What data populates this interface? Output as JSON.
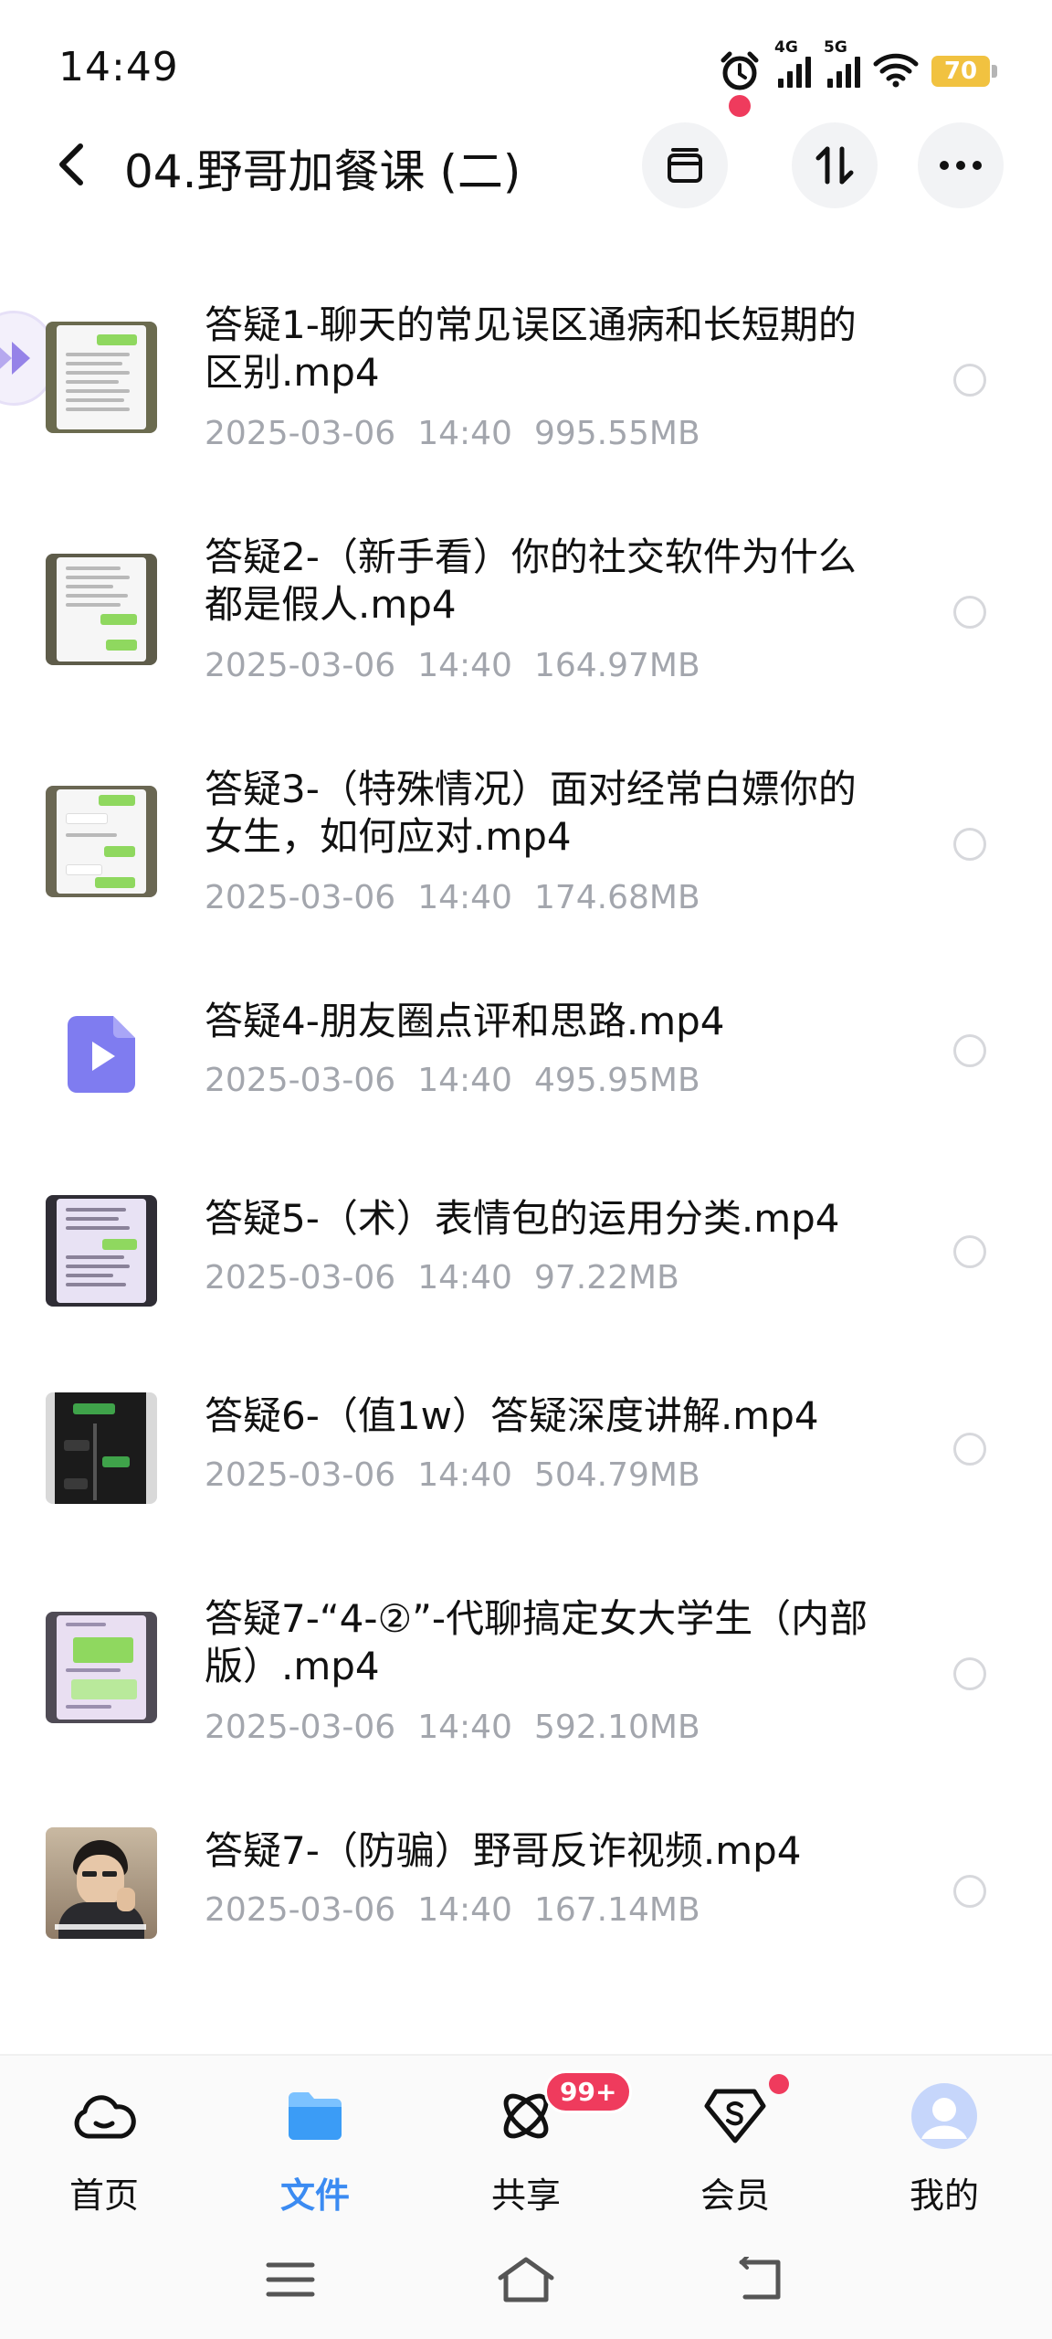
{
  "status_bar": {
    "time": "14:49",
    "signal_tags": [
      "4G",
      "5G"
    ],
    "battery": "70"
  },
  "header": {
    "title": "04.野哥加餐课 (二)"
  },
  "files": [
    {
      "name": "答疑1-聊天的常见误区通病和长短期的区别.mp4",
      "date": "2025-03-06",
      "time": "14:40",
      "size": "995.55MB",
      "thumb": "chat-screenshot"
    },
    {
      "name": "答疑2-（新手看）你的社交软件为什么都是假人.mp4",
      "date": "2025-03-06",
      "time": "14:40",
      "size": "164.97MB",
      "thumb": "chat-screenshot"
    },
    {
      "name": "答疑3-（特殊情况）面对经常白嫖你的女生，如何应对.mp4",
      "date": "2025-03-06",
      "time": "14:40",
      "size": "174.68MB",
      "thumb": "chat-screenshot"
    },
    {
      "name": "答疑4-朋友圈点评和思路.mp4",
      "date": "2025-03-06",
      "time": "14:40",
      "size": "495.95MB",
      "thumb": "video-file-icon"
    },
    {
      "name": "答疑5-（术）表情包的运用分类.mp4",
      "date": "2025-03-06",
      "time": "14:40",
      "size": "97.22MB",
      "thumb": "chat-screenshot"
    },
    {
      "name": "答疑6-（值1w）答疑深度讲解.mp4",
      "date": "2025-03-06",
      "time": "14:40",
      "size": "504.79MB",
      "thumb": "dark-chat-screenshot"
    },
    {
      "name": "答疑7-“4-②”-代聊搞定女大学生（内部版）.mp4",
      "date": "2025-03-06",
      "time": "14:40",
      "size": "592.10MB",
      "thumb": "chat-screenshot"
    },
    {
      "name": "答疑7-（防骗）野哥反诈视频.mp4",
      "date": "2025-03-06",
      "time": "14:40",
      "size": "167.14MB",
      "thumb": "person-video-frame"
    }
  ],
  "bottom_nav": {
    "items": [
      {
        "label": "首页",
        "icon": "cloud-home-icon"
      },
      {
        "label": "文件",
        "icon": "folder-icon",
        "active": true
      },
      {
        "label": "共享",
        "icon": "share-atom-icon",
        "badge": "99+"
      },
      {
        "label": "会员",
        "icon": "vip-diamond-icon"
      },
      {
        "label": "我的",
        "icon": "avatar-icon"
      }
    ]
  },
  "colors": {
    "accent": "#3b8bf2",
    "badge": "#ef3b5d",
    "meta_text": "#a3a6ad",
    "battery": "#f1c240",
    "video_icon": "#7f7cf0"
  }
}
